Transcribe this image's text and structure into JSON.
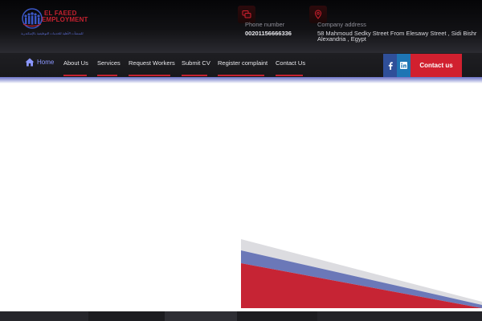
{
  "header": {
    "logo": {
      "line1": "EL FAEED",
      "line2": "EMPLOYMENT",
      "line3": "للمنشآت الأهلية للخدمات التوظيفية بالإسكندرية",
      "icon": "people-group-logo"
    },
    "phone": {
      "label": "Phone number",
      "value": "00201156666336",
      "icon": "phone-chat-icon"
    },
    "address": {
      "label": "Company address",
      "line1": "58 Mahmoud Sedky Street From Elesawy Street , Sidi Bishr",
      "line2": "Alexandria , Egypt",
      "icon": "map-pin-icon"
    }
  },
  "nav": {
    "items": [
      {
        "label": "Home",
        "icon": "home-icon",
        "active": true
      },
      {
        "label": "About Us"
      },
      {
        "label": "Services"
      },
      {
        "label": "Request Workers"
      },
      {
        "label": "Submit CV"
      },
      {
        "label": "Register complaint"
      },
      {
        "label": "Contact Us"
      }
    ],
    "social": [
      {
        "icon": "facebook-icon",
        "color": "#2f4f99"
      },
      {
        "icon": "linkedin-icon",
        "color": "#1e75b4"
      }
    ],
    "cta_label": "Contact us"
  },
  "colors": {
    "accent": "#d1202f",
    "nav_active": "#8b97ff",
    "stripe_blue": "#6b78b8",
    "stripe_gray": "#dcdce0"
  }
}
